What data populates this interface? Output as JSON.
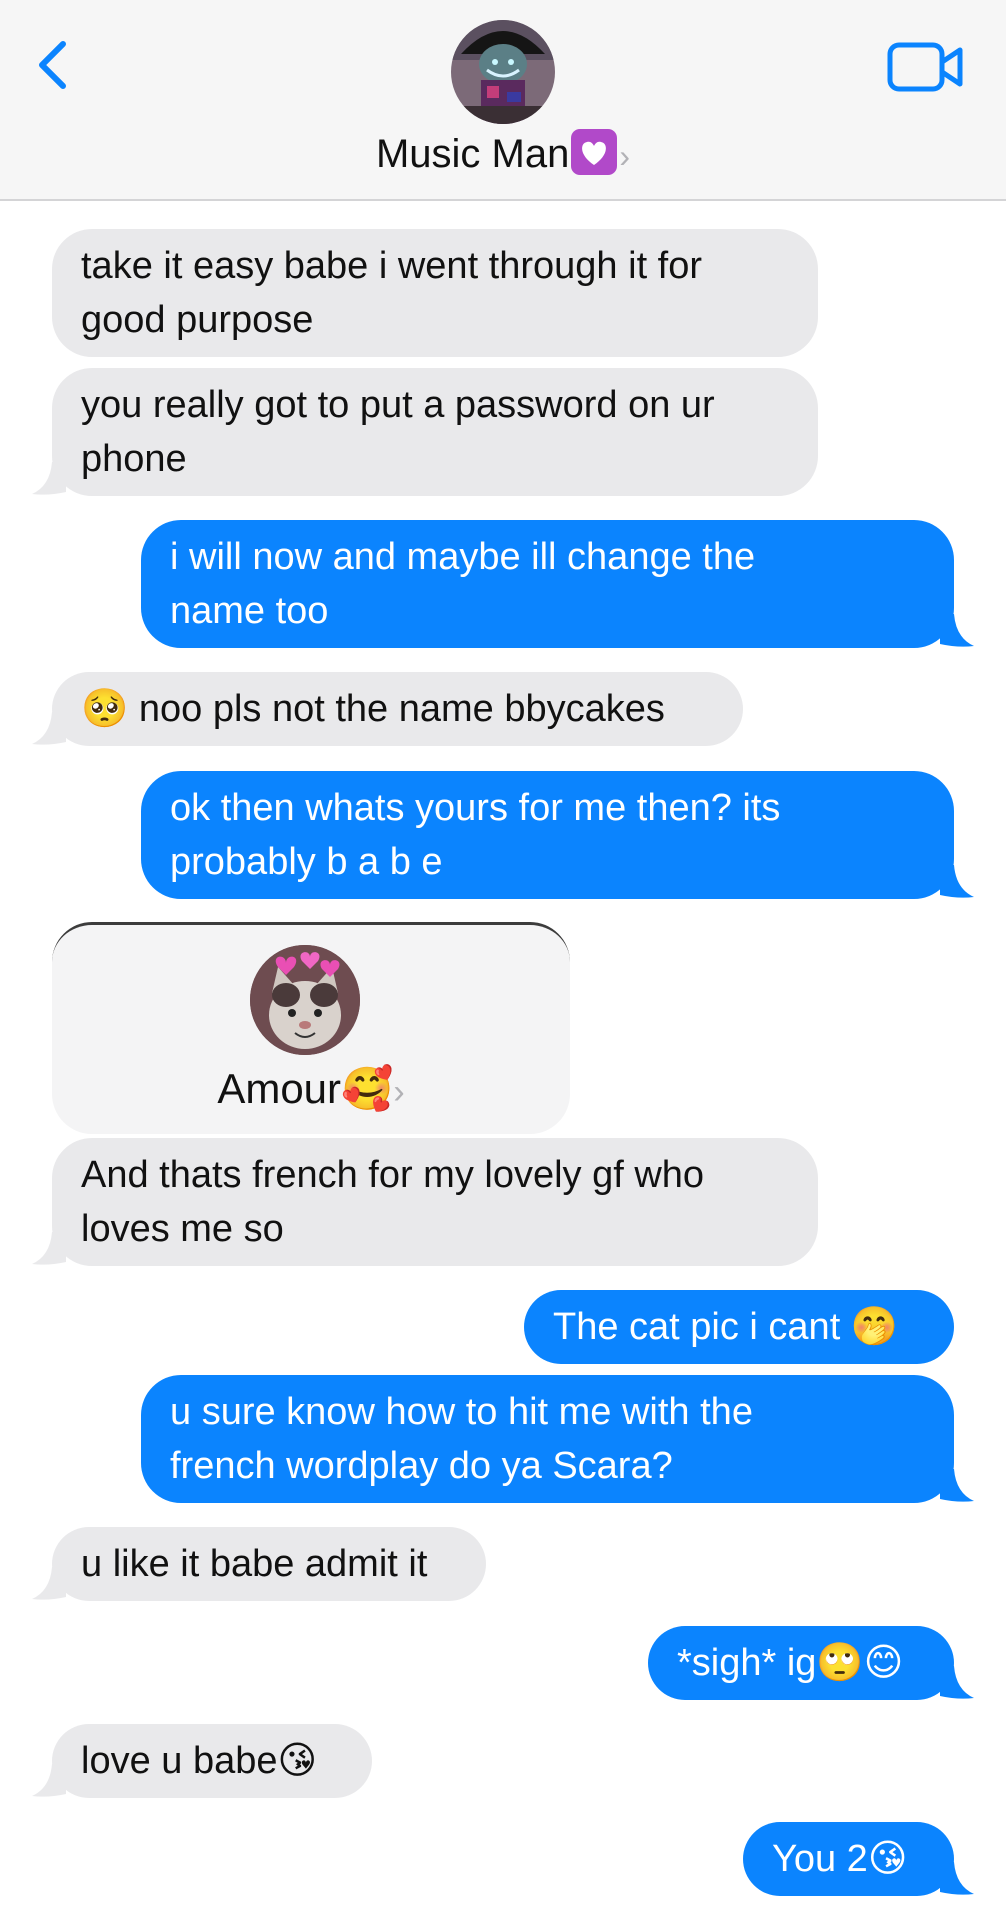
{
  "header": {
    "contact_name": "Music Man",
    "name_emoji": "💟",
    "chevron": "›"
  },
  "icons": {
    "back": "chevron-left-icon",
    "video": "video-camera-icon",
    "avatar": "contact-avatar"
  },
  "colors": {
    "accent": "#0b84fe",
    "incoming_bubble": "#e9e9eb",
    "outgoing_bubble": "#0b84fe",
    "header_bg": "#f6f6f6"
  },
  "messages": [
    {
      "dir": "in",
      "lines": [
        "take it easy babe i went through it for",
        "good purpose"
      ]
    },
    {
      "dir": "in",
      "lines": [
        "you really got to put a password on ur",
        "phone"
      ]
    },
    {
      "dir": "out",
      "lines": [
        "i will now and maybe ill change the",
        "name too"
      ]
    },
    {
      "dir": "in",
      "lines": [
        "🥺 noo pls not the name bbycakes"
      ]
    },
    {
      "dir": "out",
      "lines": [
        "ok then whats yours for me then? its",
        "probably b a b e"
      ]
    },
    {
      "dir": "in",
      "lines": [
        "And thats french for my lovely gf who",
        "loves me so"
      ]
    },
    {
      "dir": "out",
      "lines": [
        "The cat pic i cant 🤭"
      ]
    },
    {
      "dir": "out",
      "lines": [
        "u sure know how to hit me with the",
        "french wordplay do ya Scara?"
      ]
    },
    {
      "dir": "in",
      "lines": [
        "u like it babe admit it"
      ]
    },
    {
      "dir": "out",
      "lines": [
        "*sigh* ig🙄😊"
      ]
    },
    {
      "dir": "in",
      "lines": [
        "love u babe😘"
      ]
    },
    {
      "dir": "out",
      "lines": [
        "You 2😘"
      ]
    }
  ],
  "contact_card": {
    "name": "Amour",
    "emoji": "🥰",
    "chevron": "›"
  }
}
